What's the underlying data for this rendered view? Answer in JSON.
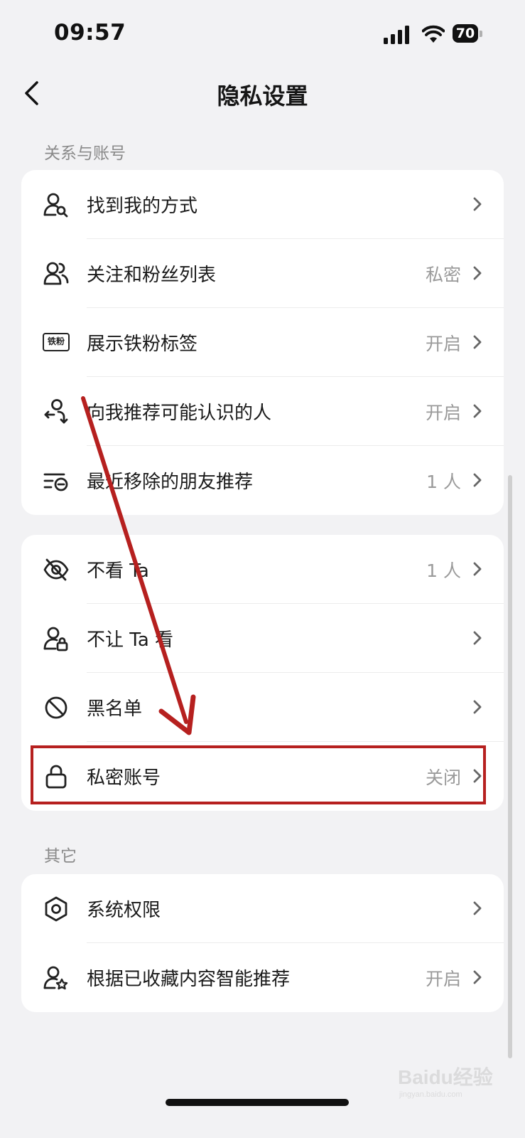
{
  "status_bar": {
    "time": "09:57",
    "battery": "70"
  },
  "nav": {
    "title": "隐私设置",
    "back_icon": "chevron-left-icon"
  },
  "sections": {
    "relations_label": "关系与账号",
    "other_label": "其它"
  },
  "card1": {
    "rows": [
      {
        "label": "找到我的方式",
        "value": "",
        "icon": "user-search-icon"
      },
      {
        "label": "关注和粉丝列表",
        "value": "私密",
        "icon": "users-icon"
      },
      {
        "label": "展示铁粉标签",
        "value": "开启",
        "icon": "fan-badge-icon",
        "icon_text": "铁粉"
      },
      {
        "label": "向我推荐可能认识的人",
        "value": "开启",
        "icon": "recommend-people-icon"
      },
      {
        "label": "最近移除的朋友推荐",
        "value": "1 人",
        "icon": "removed-list-icon"
      }
    ]
  },
  "card2": {
    "rows": [
      {
        "label": "不看 Ta",
        "value": "1 人",
        "icon": "eye-off-icon"
      },
      {
        "label": "不让 Ta 看",
        "value": "",
        "icon": "user-lock-icon"
      },
      {
        "label": "黑名单",
        "value": "",
        "icon": "block-icon"
      },
      {
        "label": "私密账号",
        "value": "关闭",
        "icon": "lock-icon"
      }
    ]
  },
  "card3": {
    "rows": [
      {
        "label": "系统权限",
        "value": "",
        "icon": "hexagon-settings-icon"
      },
      {
        "label": "根据已收藏内容智能推荐",
        "value": "开启",
        "icon": "user-star-icon"
      }
    ]
  },
  "annotation": {
    "color": "#b6201f"
  },
  "watermark": {
    "text": "Baidu经验",
    "subtext": "jingyan.baidu.com"
  }
}
